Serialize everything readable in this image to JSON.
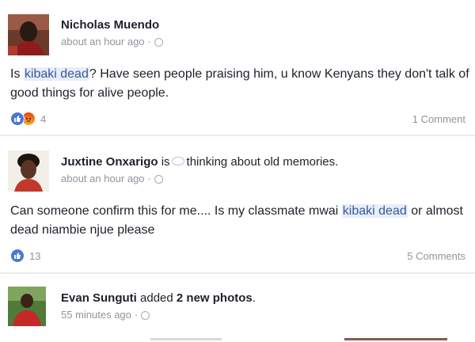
{
  "posts": [
    {
      "author": "Nicholas Muendo",
      "time": "about an hour ago",
      "text_before": "Is ",
      "highlight": "kibaki dead",
      "text_after": "? Have seen people praising him, u know Kenyans they don't talk of good things for alive people.",
      "reactions_count": "4",
      "comments": "1 Comment"
    },
    {
      "author": "Juxtine Onxarigo",
      "connector": "is",
      "activity": "thinking about old memories.",
      "time": "about an hour ago",
      "text_before": "Can someone confirm this for me.... Is my classmate mwai ",
      "highlight": "kibaki dead",
      "text_after": " or almost dead niambie njue please",
      "reactions_count": "13",
      "comments": "5 Comments"
    },
    {
      "author": "Evan Sunguti",
      "action_prefix": "added",
      "action_link": "2 new photos",
      "action_suffix": ".",
      "time": "55 minutes ago"
    }
  ],
  "colors": {
    "link": "#365899",
    "meta": "#90949c",
    "highlight_bg": "#e8eef9",
    "like": "#4a76d6",
    "angry": "#e9410f"
  },
  "icons": [
    "globe-icon",
    "like-reaction-icon",
    "angry-reaction-icon",
    "thought-bubble-icon"
  ]
}
